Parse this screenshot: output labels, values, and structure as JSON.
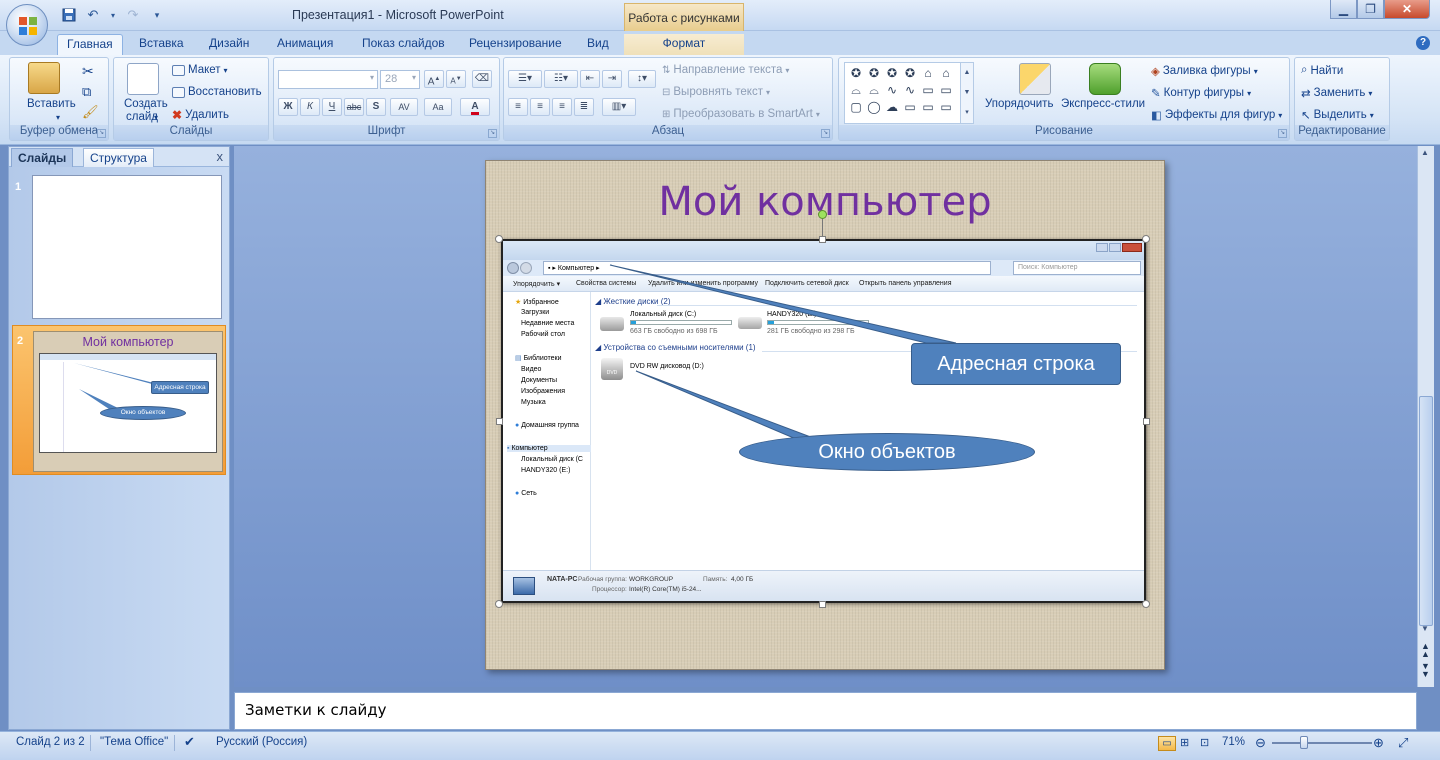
{
  "window": {
    "title": "Презентация1 - Microsoft PowerPoint",
    "context_tool": "Работа с рисунками"
  },
  "qat": {
    "save_icon": "save-icon",
    "undo_icon": "undo-icon",
    "redo_icon": "redo-icon"
  },
  "tabs": [
    "Главная",
    "Вставка",
    "Дизайн",
    "Анимация",
    "Показ слайдов",
    "Рецензирование",
    "Вид",
    "Формат"
  ],
  "active_tab": "Главная",
  "ribbon": {
    "clipboard": {
      "name": "Буфер обмена",
      "paste": "Вставить"
    },
    "slides": {
      "name": "Слайды",
      "new_slide": "Создать",
      "new_slide2": "слайд",
      "layout": "Макет",
      "reset": "Восстановить",
      "delete": "Удалить"
    },
    "font": {
      "name": "Шрифт",
      "font_size": "28",
      "bold": "Ж",
      "italic": "К",
      "underline": "Ч",
      "strike": "abc",
      "shadow": "S",
      "spacing": "AV",
      "case": "Aa"
    },
    "paragraph": {
      "name": "Абзац",
      "text_direction": "Направление текста",
      "align_text": "Выровнять текст",
      "smartart": "Преобразовать в SmartArt"
    },
    "drawing": {
      "name": "Рисование",
      "arrange": "Упорядочить",
      "quick_styles": "Экспресс-стили",
      "fill": "Заливка фигуры",
      "outline": "Контур фигуры",
      "effects": "Эффекты для фигур"
    },
    "editing": {
      "name": "Редактирование",
      "find": "Найти",
      "replace": "Заменить",
      "select": "Выделить"
    }
  },
  "left_panel": {
    "tab_slides": "Слайды",
    "tab_outline": "Структура",
    "close": "x",
    "slide1_num": "1",
    "slide2_num": "2",
    "thumb2_title": "Мой компьютер",
    "thumb2_callout1": "Адресная строка",
    "thumb2_callout2": "Окно объектов"
  },
  "slide": {
    "title": "Мой компьютер",
    "callout_address": "Адресная строка",
    "callout_objects": "Окно объектов"
  },
  "explorer": {
    "address": "Компьютер",
    "search_placeholder": "Поиск: Компьютер",
    "toolbar": [
      "Упорядочить ▾",
      "Свойства системы",
      "Удалить или изменить программу",
      "Подключить сетевой диск",
      "Открыть панель управления"
    ],
    "nav": [
      "Избранное",
      "Загрузки",
      "Недавние места",
      "Рабочий стол",
      "Библиотеки",
      "Видео",
      "Документы",
      "Изображения",
      "Музыка",
      "Домашняя группа",
      "Компьютер",
      "Локальный диск (C",
      "HANDY320 (E:)",
      "Сеть"
    ],
    "hdd_header": "Жесткие диски (2)",
    "disk_c": "Локальный диск (C:)",
    "disk_c_free": "663 ГБ свободно из 698 ГБ",
    "disk_c_used_frac": 0.05,
    "disk_e": "HANDY320 (E:)",
    "disk_e_free": "281 ГБ свободно из 298 ГБ",
    "disk_e_used_frac": 0.06,
    "removable_header": "Устройства со съемными носителями (1)",
    "dvd": "DVD RW дисковод (D:)",
    "pc_name": "NATA-PC",
    "workgroup_label": "Рабочая группа:",
    "workgroup": "WORKGROUP",
    "memory_label": "Память:",
    "memory": "4,00 ГБ",
    "cpu_label": "Процессор:",
    "cpu": "Intel(R) Core(TM) i5-24..."
  },
  "notes": {
    "placeholder": "Заметки к слайду"
  },
  "status": {
    "slide": "Слайд 2 из 2",
    "theme": "\"Тема Office\"",
    "language": "Русский (Россия)",
    "zoom": "71%"
  },
  "colors": {
    "title_purple": "#7030a0",
    "callout_blue": "#4f81bd",
    "ribbon_blue": "#15428b"
  }
}
